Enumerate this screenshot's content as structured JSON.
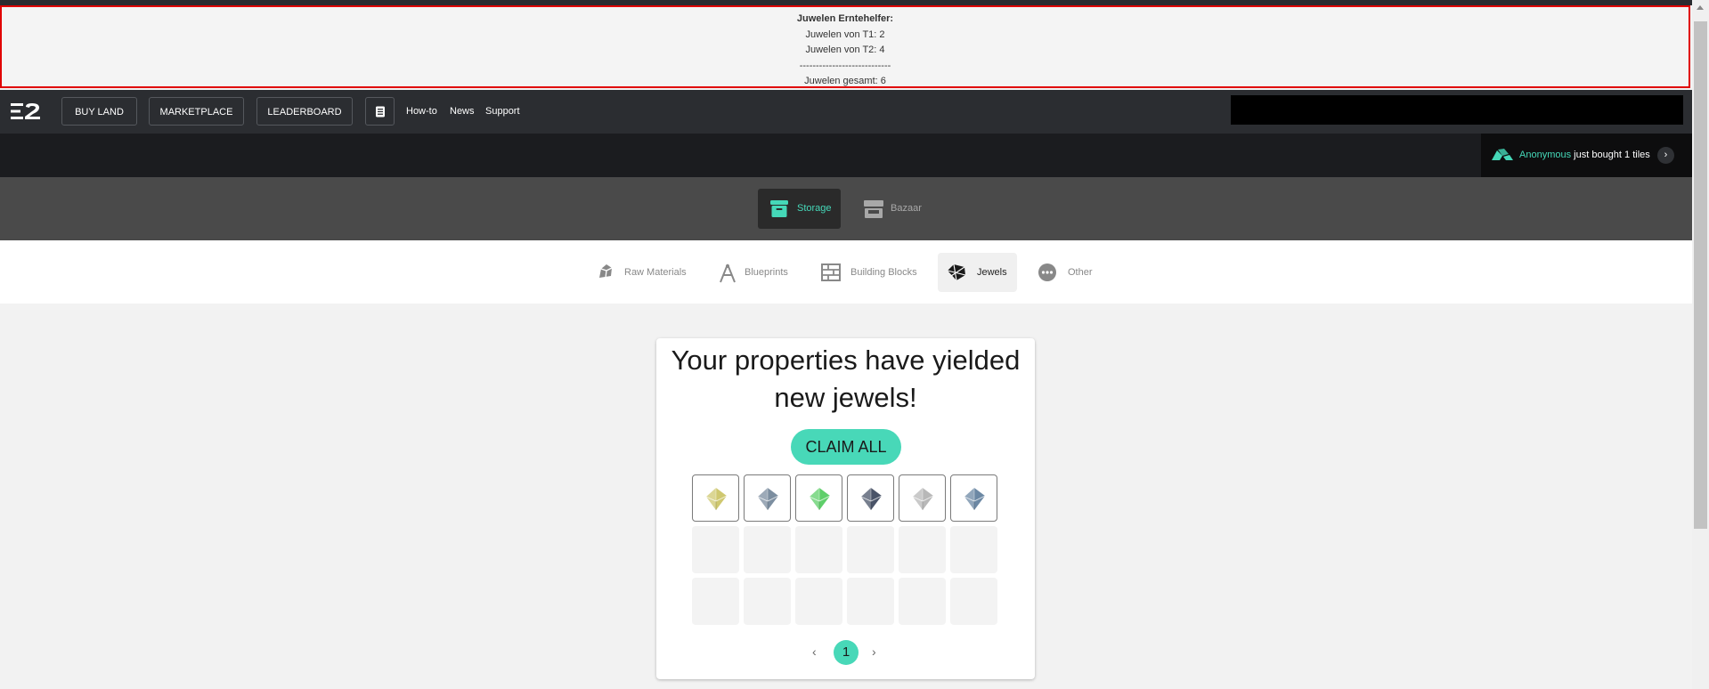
{
  "helper": {
    "title": "Juwelen Erntehelfer:",
    "line1": "Juwelen von T1: 2",
    "line2": "Juwelen von T2: 4",
    "divider": "----------------------------",
    "total": "Juwelen gesamt: 6",
    "border_color": "#e00000"
  },
  "nav": {
    "logo": "E2 logo",
    "buy_land": "BUY LAND",
    "marketplace": "MARKETPLACE",
    "leaderboard": "LEADERBOARD",
    "doc_icon": "document-icon",
    "howto": "How-to",
    "news": "News",
    "support": "Support"
  },
  "ticker": {
    "user": "Anonymous",
    "action": "just bought 1 tiles",
    "arrow": "›"
  },
  "storage_tabs": [
    {
      "label": "Storage",
      "icon": "storage-box-icon",
      "active": true
    },
    {
      "label": "Bazaar",
      "icon": "bazaar-shop-icon",
      "active": false
    }
  ],
  "categories": [
    {
      "label": "Raw Materials",
      "icon": "raw-materials-icon",
      "active": false
    },
    {
      "label": "Blueprints",
      "icon": "blueprints-icon",
      "active": false
    },
    {
      "label": "Building Blocks",
      "icon": "building-blocks-icon",
      "active": false
    },
    {
      "label": "Jewels",
      "icon": "jewel-icon",
      "active": true
    },
    {
      "label": "Other",
      "icon": "more-dots-icon",
      "active": false
    }
  ],
  "card": {
    "headline_line1": "Your properties have yielded",
    "headline_line2": "new jewels!",
    "claim_label": "CLAIM ALL",
    "jewels": [
      {
        "name": "yellow-jewel",
        "color": "#cfc870"
      },
      {
        "name": "slate-blue-jewel",
        "color": "#7c8ea0"
      },
      {
        "name": "green-jewel",
        "color": "#5fcf6a"
      },
      {
        "name": "dark-slate-jewel",
        "color": "#4a5468"
      },
      {
        "name": "grey-jewel",
        "color": "#b8b8b8"
      },
      {
        "name": "blue-grey-jewel",
        "color": "#6c88a4"
      }
    ],
    "page": "1",
    "prev": "‹",
    "next": "›"
  },
  "colors": {
    "accent": "#45d8b8",
    "nav_bg": "#2b2d31",
    "tab_bg": "#4a4a4a"
  }
}
